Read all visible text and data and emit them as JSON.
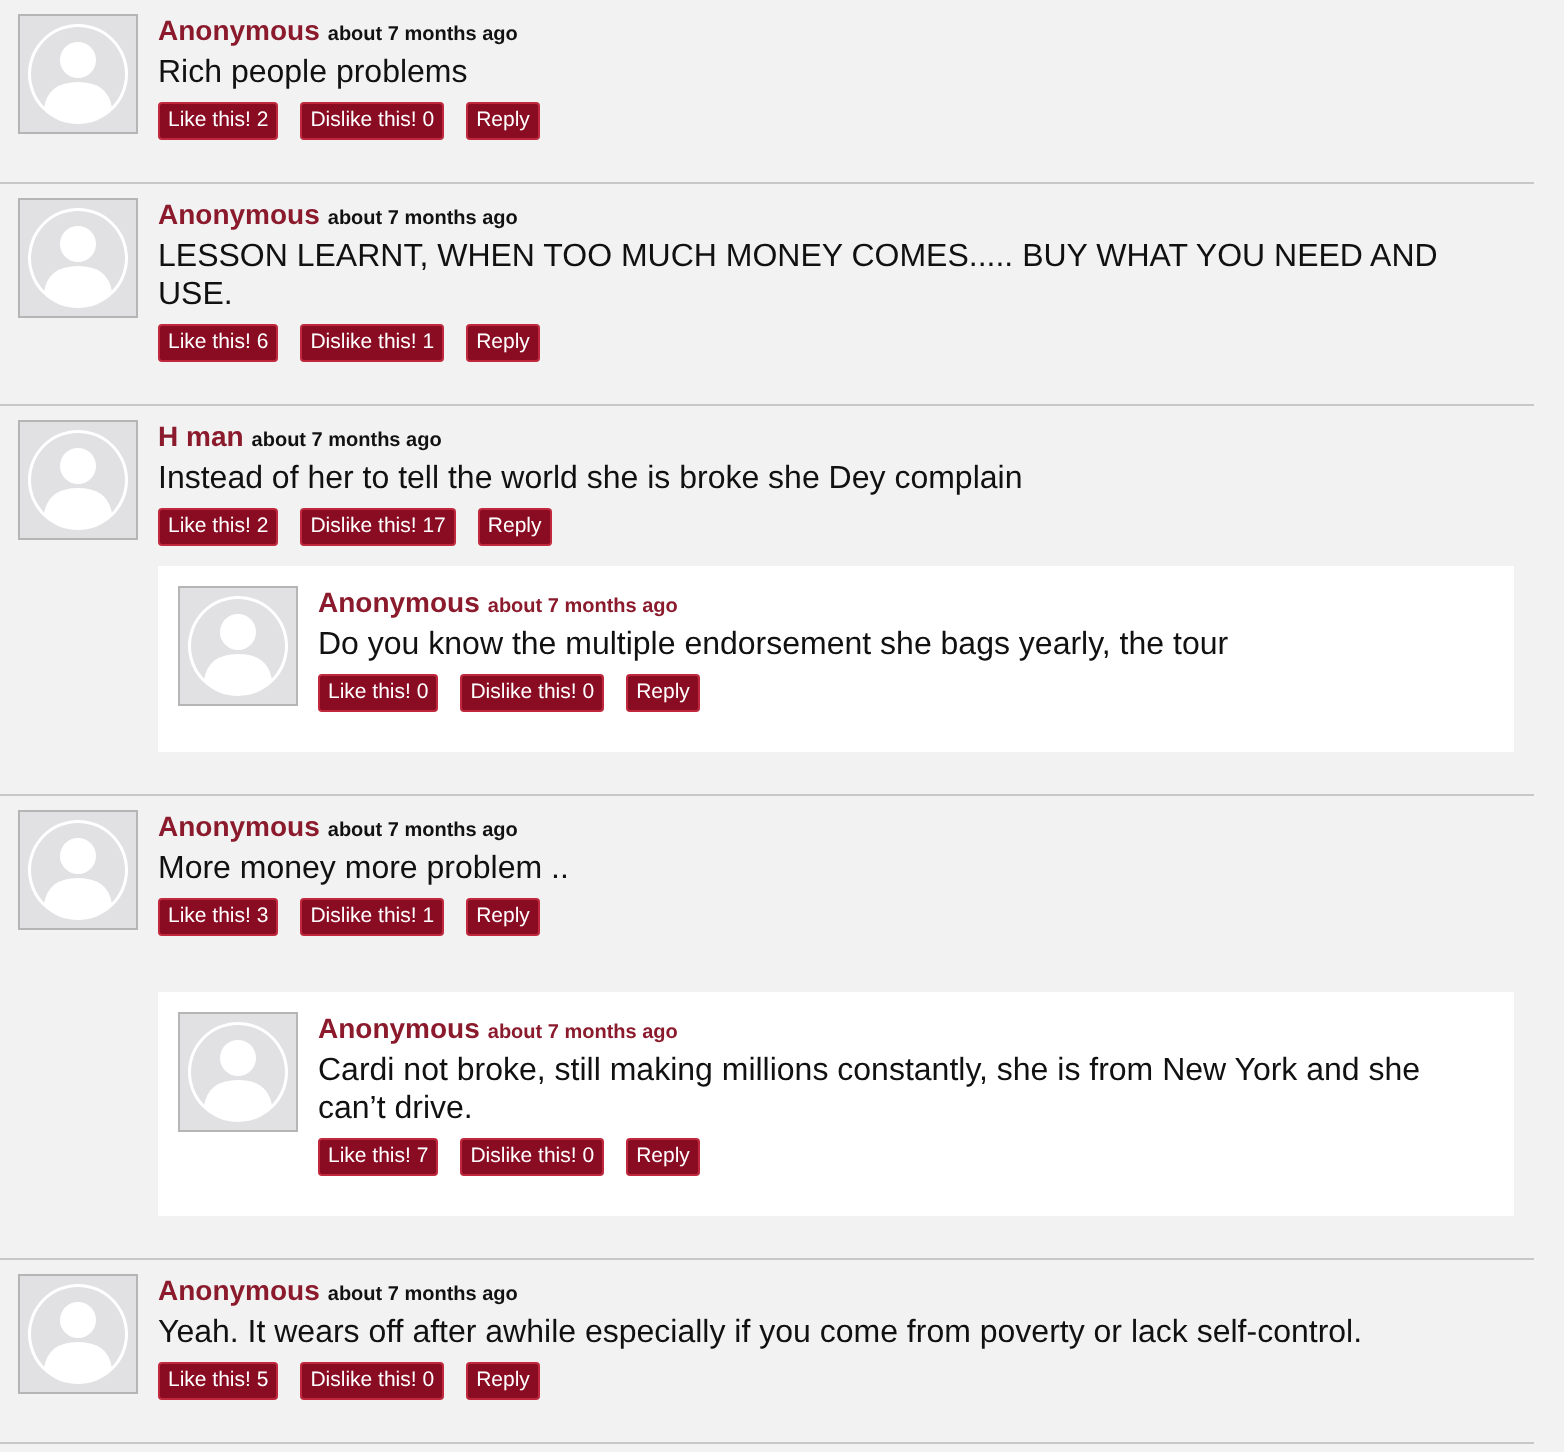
{
  "comments": [
    {
      "author": "Anonymous",
      "time": "about 7 months ago",
      "text": "Rich people problems",
      "like": "Like this! 2",
      "dislike": "Dislike this! 0",
      "reply": "Reply"
    },
    {
      "author": "Anonymous",
      "time": "about 7 months ago",
      "text": "LESSON LEARNT, WHEN TOO MUCH MONEY COMES..... BUY WHAT YOU NEED AND USE.",
      "like": "Like this! 6",
      "dislike": "Dislike this! 1",
      "reply": "Reply"
    },
    {
      "author": "H man",
      "time": "about 7 months ago",
      "text": "Instead of her to tell the world she is broke she Dey complain",
      "like": "Like this! 2",
      "dislike": "Dislike this! 17",
      "reply": "Reply",
      "children": [
        {
          "author": "Anonymous",
          "time": "about 7 months ago",
          "text": "Do you know the multiple endorsement she bags yearly, the tour",
          "like": "Like this! 0",
          "dislike": "Dislike this! 0",
          "reply": "Reply"
        }
      ]
    },
    {
      "author": "Anonymous",
      "time": "about 7 months ago",
      "text": "More money more problem ..",
      "like": "Like this! 3",
      "dislike": "Dislike this! 1",
      "reply": "Reply",
      "children": [
        {
          "author": "Anonymous",
          "time": "about 7 months ago",
          "text": "Cardi not broke, still making millions constantly, she is from New York and she can’t drive.",
          "like": "Like this! 7",
          "dislike": "Dislike this! 0",
          "reply": "Reply"
        }
      ]
    },
    {
      "author": "Anonymous",
      "time": "about 7 months ago",
      "text": "Yeah. It wears off after awhile especially if you come from poverty or lack self-control.",
      "like": "Like this! 5",
      "dislike": "Dislike this! 0",
      "reply": "Reply"
    }
  ]
}
